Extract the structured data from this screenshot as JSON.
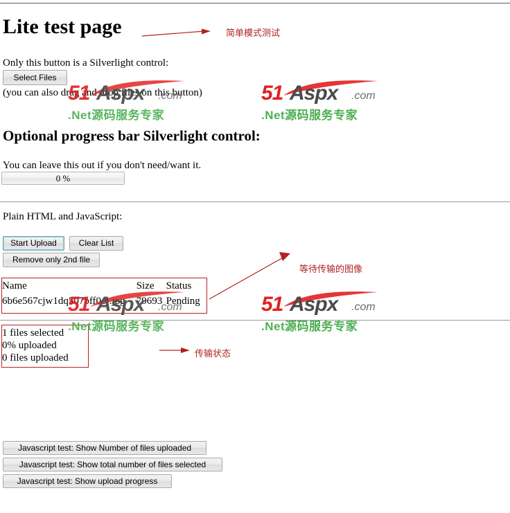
{
  "page": {
    "title": "Lite test page",
    "section_heading": "Optional progress bar Silverlight control:"
  },
  "intro": {
    "silverlight_note": "Only this button is a Silverlight control:",
    "dragdrop_note": "(you can also drag and drop files on this button)",
    "leave_out_note": "You can leave this out if you don't need/want it.",
    "plain_note": "Plain HTML and JavaScript:"
  },
  "buttons": {
    "select_files": "Select Files",
    "start_upload": "Start Upload",
    "clear_list": "Clear List",
    "remove_second": "Remove only 2nd file",
    "js_count_uploaded": "Javascript test: Show Number of files uploaded",
    "js_total_selected": "Javascript test: Show total number of files selected",
    "js_upload_progress": "Javascript test: Show upload progress"
  },
  "progress": {
    "label": "0 %",
    "value": 0
  },
  "file_table": {
    "columns": [
      "Name",
      "Size",
      "Status"
    ],
    "rows": [
      {
        "name": "6b6e567cjw1dq507bff0oj.jpg",
        "size": "79693",
        "status": "Pending"
      }
    ]
  },
  "status": {
    "files_selected": "1 files selected",
    "percent_uploaded": "0% uploaded",
    "files_uploaded": "0 files uploaded"
  },
  "annotations": {
    "color": "#b22222",
    "title_note": "简单模式测试",
    "files_note": "等待传输的图像",
    "status_note": "传输状态"
  },
  "watermark": {
    "brand_prefix": "51",
    "brand_main": "Aspx",
    "brand_tld": ".com",
    "subtitle": ".Net源码服务专家",
    "colors": {
      "red": "#e02020",
      "gray": "#4a4a4a",
      "green": "#4caf50"
    }
  }
}
